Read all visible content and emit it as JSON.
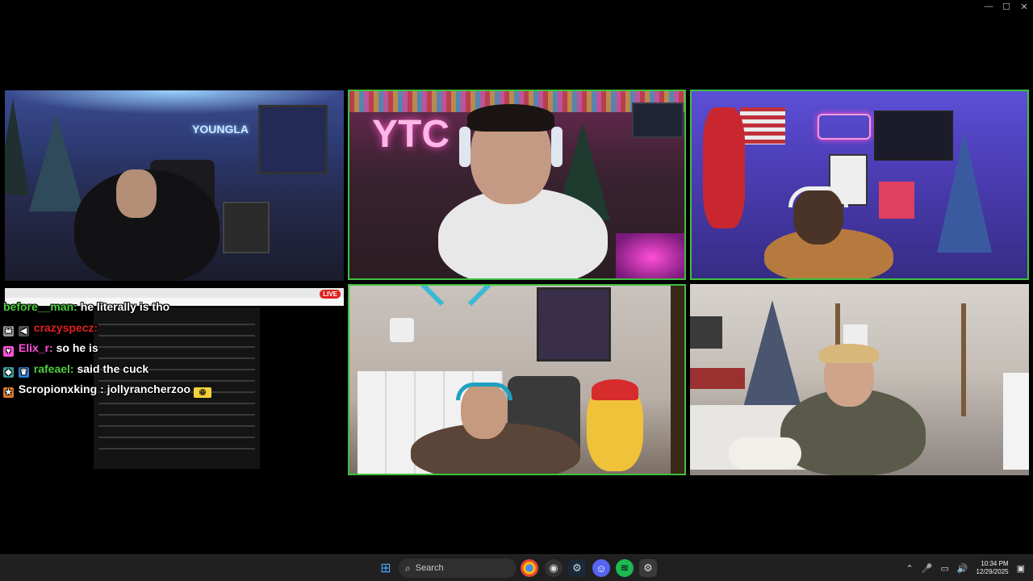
{
  "window_controls": {
    "minimize": "—",
    "maximize": "☐",
    "close": "✕"
  },
  "tiles": [
    {
      "neon": "YOUNGLA"
    },
    {
      "neon": "YTC"
    },
    {
      "neon": ""
    },
    {
      "neon": ""
    },
    {
      "neon": ""
    }
  ],
  "chat": {
    "live_badge": "LIVE",
    "messages": [
      {
        "user": "before__man:",
        "text": "he literally is tho",
        "user_color": "#4ccd3c"
      },
      {
        "user": "crazyspecz:",
        "text": "",
        "user_color": "#e02020"
      },
      {
        "user": "Elix_r:",
        "text": "so he is",
        "user_color": "#ff4fd8"
      },
      {
        "user": "rafeael:",
        "text": "said the cuck",
        "user_color": "#4ccd3c"
      },
      {
        "user": "Scropionxking :",
        "text": "jollyrancherzoo",
        "user_color": "#ffffff"
      }
    ]
  },
  "taskbar": {
    "search_label": "Search",
    "clock_time": "10:34 PM",
    "clock_date": "12/29/2025",
    "apps": [
      "windows-start",
      "chrome",
      "obs",
      "steam",
      "discord",
      "spotify",
      "settings"
    ]
  },
  "colors": {
    "active_border": "#3fbf3f",
    "taskbar_bg": "#202020"
  }
}
